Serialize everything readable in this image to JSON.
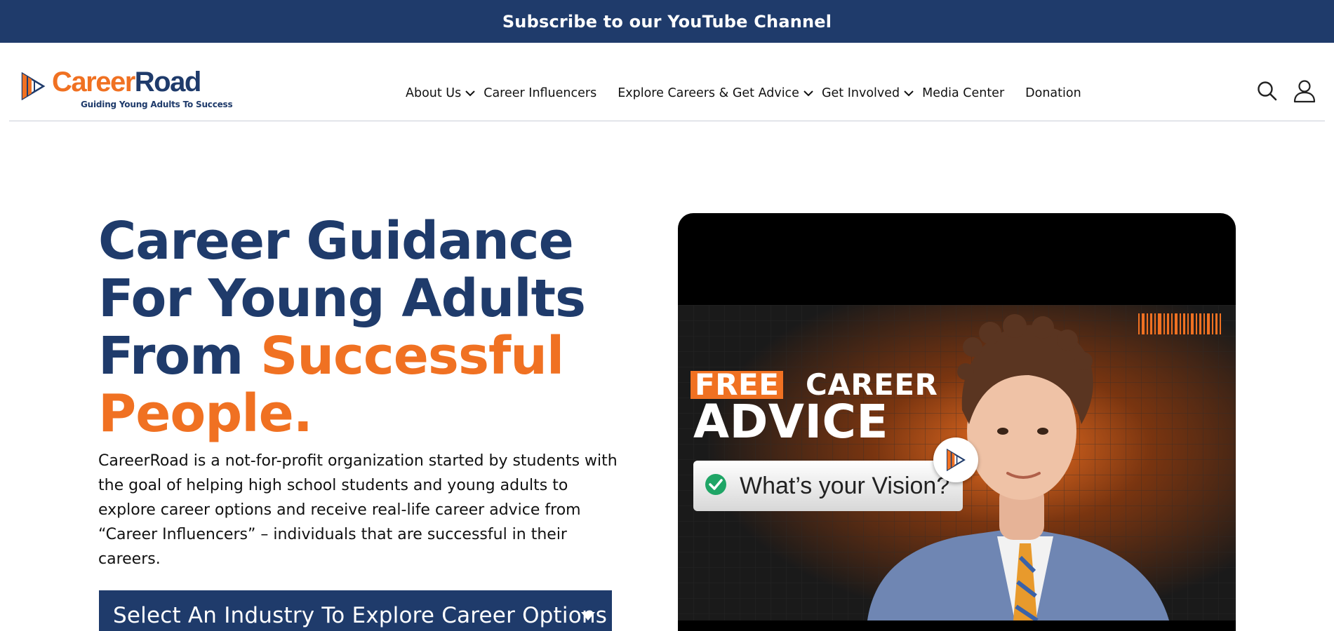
{
  "banner": {
    "text": "Subscribe to our YouTube Channel"
  },
  "logo": {
    "career": "Career",
    "road": "Road",
    "tagline": "Guiding Young Adults To Success"
  },
  "nav": {
    "items": [
      {
        "label": "About Us",
        "has_dropdown": true
      },
      {
        "label": "Career Influencers",
        "has_dropdown": false
      },
      {
        "label": "Explore Careers & Get Advice",
        "has_dropdown": true
      },
      {
        "label": "Get Involved",
        "has_dropdown": true
      },
      {
        "label": "Media Center",
        "has_dropdown": false
      },
      {
        "label": "Donation",
        "has_dropdown": false
      }
    ]
  },
  "header_icons": {
    "search": "search-icon",
    "account": "user-icon"
  },
  "hero": {
    "title_line1": "Career Guidance",
    "title_line2": "For Young Adults",
    "title_line3_start": "From ",
    "title_line3_highlight": "Successful",
    "title_line4": "People.",
    "description": "CareerRoad is a not-for-profit organization started by students with the goal of helping high school students and young adults to explore career options and receive real-life career advice from “Career Influencers” – individuals that are successful in their careers.",
    "industry_select": "Select An Industry To Explore Career Options"
  },
  "video": {
    "free": "FREE",
    "career": "CAREER",
    "advice": "ADVICE",
    "vision": "What’s your Vision?"
  },
  "colors": {
    "navy": "#1f3b6b",
    "orange": "#f07122",
    "white": "#ffffff",
    "black": "#000000"
  }
}
